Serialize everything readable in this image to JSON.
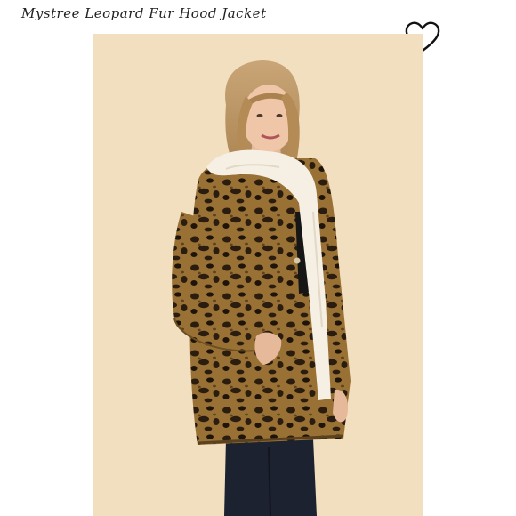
{
  "product": {
    "title": "Mystree Leopard Fur Hood Jacket"
  },
  "icons": {
    "like": "heart-outline-icon"
  },
  "colors": {
    "background": "#ffffff",
    "photo_backdrop": "#f2dfc0",
    "title_text": "#222222"
  }
}
